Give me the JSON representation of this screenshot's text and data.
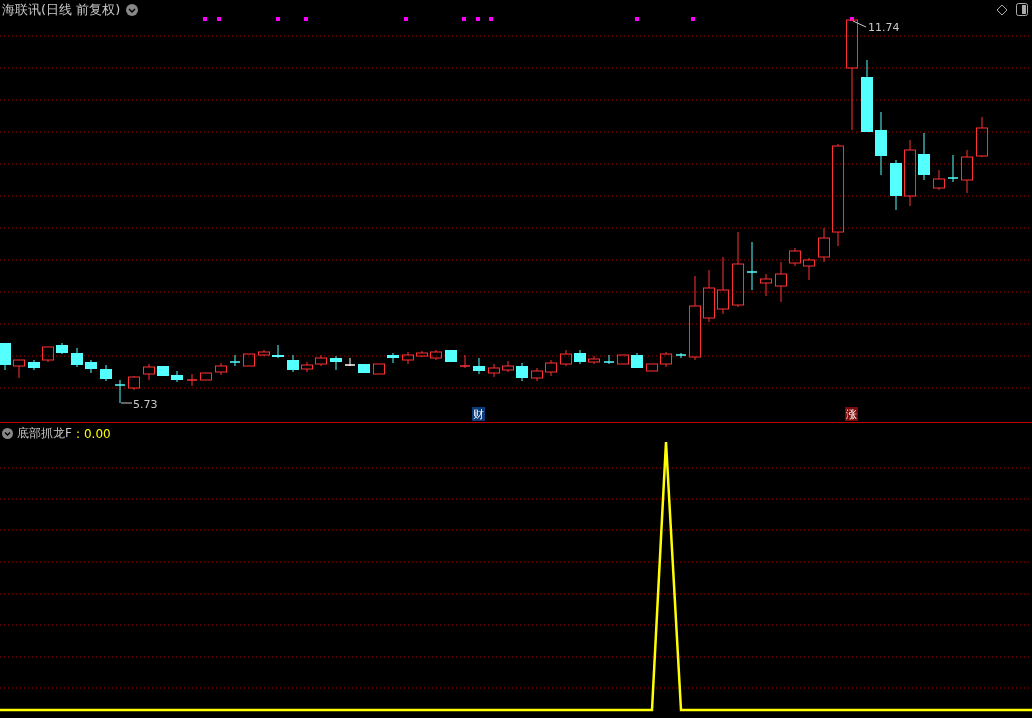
{
  "chart_header": {
    "title": "海联讯(日线 前复权)"
  },
  "price_labels": [
    {
      "kind": "high",
      "text": "11.74"
    },
    {
      "kind": "low",
      "text": "5.73"
    }
  ],
  "event_badges": [
    {
      "text": "财",
      "color": "#0b3b7a"
    },
    {
      "text": "涨",
      "color": "#7a0b0b"
    }
  ],
  "indicator": {
    "name": "底部抓龙F",
    "separator": ":",
    "value": "0.00"
  }
}
